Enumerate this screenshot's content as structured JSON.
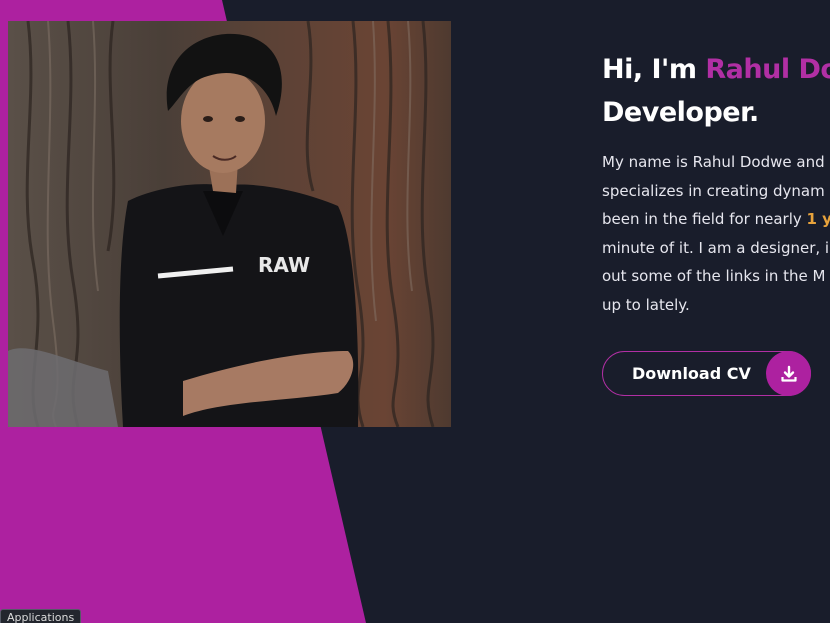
{
  "colors": {
    "background": "#191d2b",
    "accent_magenta": "#ad21a0",
    "accent_text": "#b12fa4",
    "highlight_orange": "#e8a33c",
    "text_white": "#ffffff"
  },
  "hero": {
    "greeting": "Hi, I'm ",
    "name": "Rahul Dodwe",
    "title_line2": "Developer.",
    "description": {
      "line1": "My name is Rahul Dodwe and",
      "line2": "specializes in creating dynam",
      "line3_before": "been in the field for nearly ",
      "line3_highlight": "1 y",
      "line4": "minute of it. I am a designer, i",
      "line5": "out some of the links in the M",
      "line6": "up to lately."
    }
  },
  "cv_button": {
    "label": "Download CV",
    "icon": "download-icon"
  },
  "profile_photo": {
    "shirt_text": "RAW"
  },
  "taskbar": {
    "tooltip": "Applications"
  }
}
